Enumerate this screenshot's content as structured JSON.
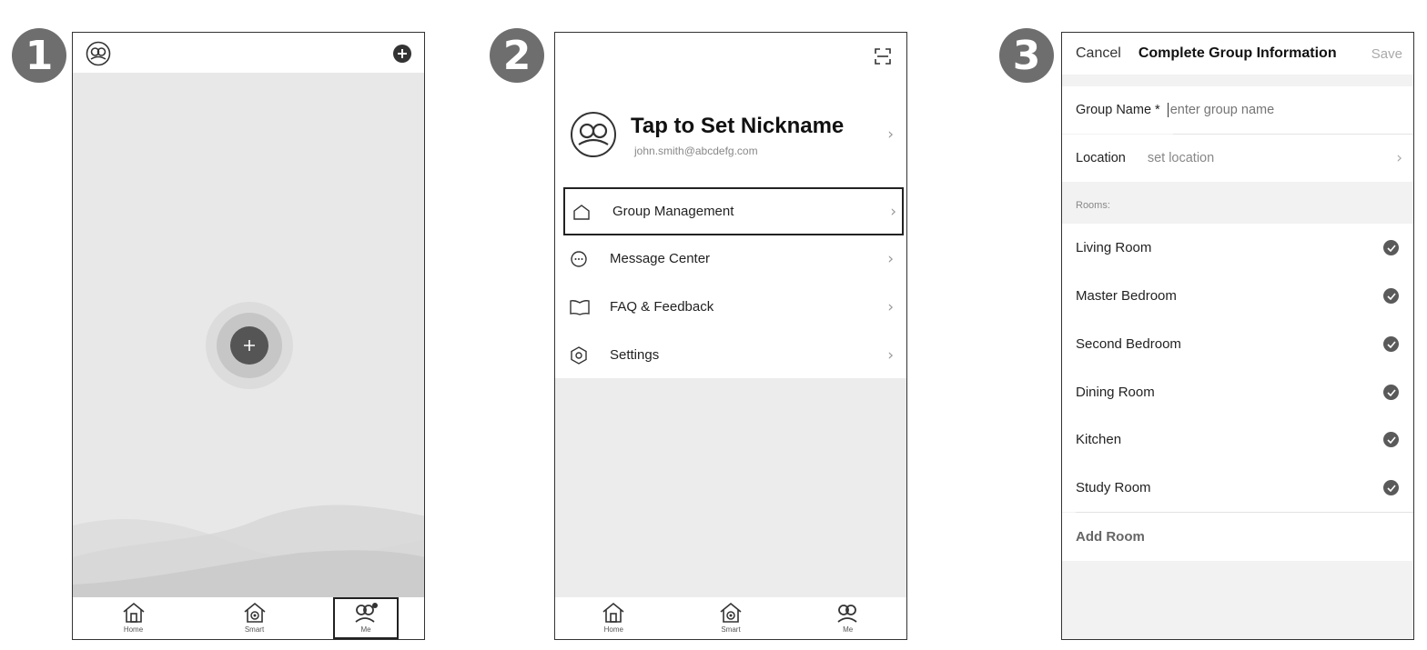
{
  "steps": [
    "1",
    "2",
    "3"
  ],
  "screen1": {
    "tabs": [
      {
        "label": "Home",
        "icon": "home-icon"
      },
      {
        "label": "Smart",
        "icon": "smart-icon"
      },
      {
        "label": "Me",
        "icon": "me-icon"
      }
    ]
  },
  "screen2": {
    "profile": {
      "nickname": "Tap to Set Nickname",
      "email": "john.smith@abcdefg.com"
    },
    "menu": [
      {
        "label": "Group Management",
        "icon": "home-outline-icon"
      },
      {
        "label": "Message Center",
        "icon": "message-icon"
      },
      {
        "label": "FAQ & Feedback",
        "icon": "book-icon"
      },
      {
        "label": "Settings",
        "icon": "settings-icon"
      }
    ],
    "tabs": [
      {
        "label": "Home",
        "icon": "home-icon"
      },
      {
        "label": "Smart",
        "icon": "smart-icon"
      },
      {
        "label": "Me",
        "icon": "me-icon"
      }
    ]
  },
  "screen3": {
    "header": {
      "cancel": "Cancel",
      "title": "Complete Group Information",
      "save": "Save"
    },
    "group_name_label": "Group Name *",
    "group_name_placeholder": "enter group name",
    "location_label": "Location",
    "location_value": "set location",
    "rooms_header": "Rooms:",
    "rooms": [
      "Living Room",
      "Master Bedroom",
      "Second Bedroom",
      "Dining Room",
      "Kitchen",
      "Study Room"
    ],
    "add_room": "Add Room"
  },
  "colors": {
    "canvas_gray": "#e8e8e8",
    "badge_gray": "#6e6e6e",
    "check_gray": "#5a5a5a",
    "button_dark": "#555555"
  }
}
